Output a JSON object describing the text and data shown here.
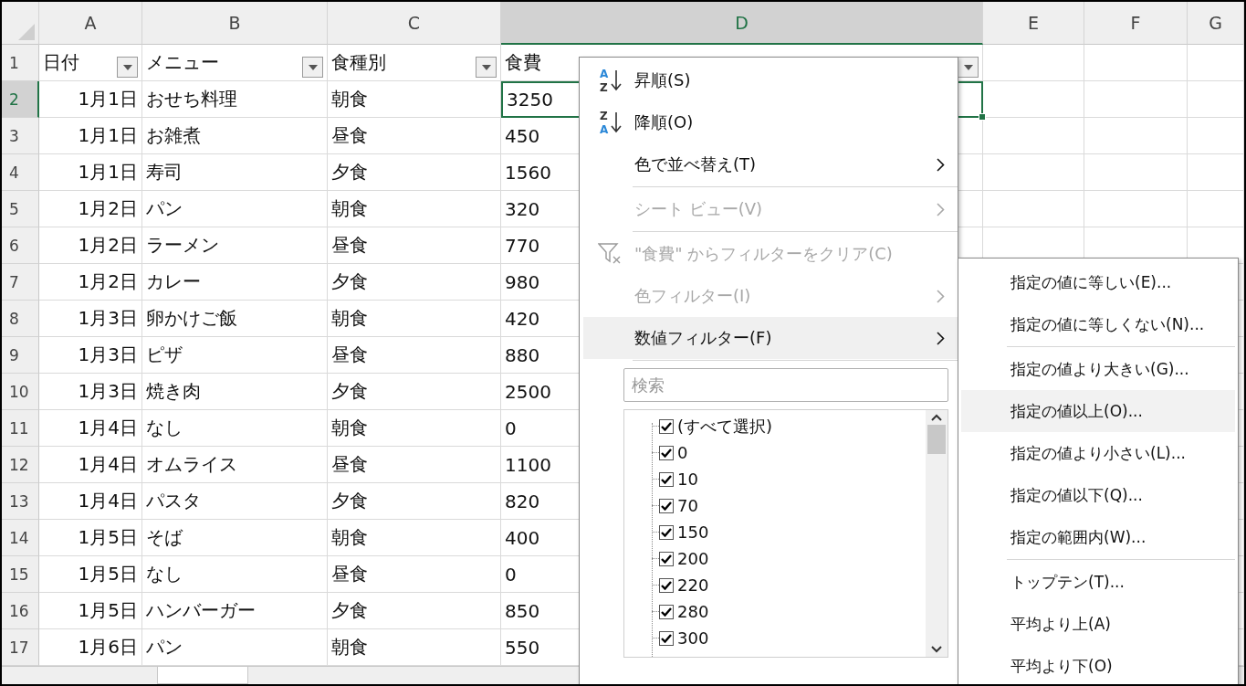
{
  "sheet": {
    "columns": [
      {
        "label": "A",
        "selected": false
      },
      {
        "label": "B",
        "selected": false
      },
      {
        "label": "C",
        "selected": false
      },
      {
        "label": "D",
        "selected": true
      },
      {
        "label": "E",
        "selected": false
      },
      {
        "label": "F",
        "selected": false
      },
      {
        "label": "G",
        "selected": false
      }
    ],
    "header_row": {
      "number": "1",
      "cells": [
        "日付",
        "メニュー",
        "食種別",
        "食費"
      ]
    },
    "rows": [
      {
        "number": "2",
        "selected": true,
        "cells": [
          "1月1日",
          "おせち料理",
          "朝食",
          "3250"
        ]
      },
      {
        "number": "3",
        "selected": false,
        "cells": [
          "1月1日",
          "お雑煮",
          "昼食",
          "450"
        ]
      },
      {
        "number": "4",
        "selected": false,
        "cells": [
          "1月1日",
          "寿司",
          "夕食",
          "1560"
        ]
      },
      {
        "number": "5",
        "selected": false,
        "cells": [
          "1月2日",
          "パン",
          "朝食",
          "320"
        ]
      },
      {
        "number": "6",
        "selected": false,
        "cells": [
          "1月2日",
          "ラーメン",
          "昼食",
          "770"
        ]
      },
      {
        "number": "7",
        "selected": false,
        "cells": [
          "1月2日",
          "カレー",
          "夕食",
          "980"
        ]
      },
      {
        "number": "8",
        "selected": false,
        "cells": [
          "1月3日",
          "卵かけご飯",
          "朝食",
          "420"
        ]
      },
      {
        "number": "9",
        "selected": false,
        "cells": [
          "1月3日",
          "ピザ",
          "昼食",
          "880"
        ]
      },
      {
        "number": "10",
        "selected": false,
        "cells": [
          "1月3日",
          "焼き肉",
          "夕食",
          "2500"
        ]
      },
      {
        "number": "11",
        "selected": false,
        "cells": [
          "1月4日",
          "なし",
          "朝食",
          "0"
        ]
      },
      {
        "number": "12",
        "selected": false,
        "cells": [
          "1月4日",
          "オムライス",
          "昼食",
          "1100"
        ]
      },
      {
        "number": "13",
        "selected": false,
        "cells": [
          "1月4日",
          "パスタ",
          "夕食",
          "820"
        ]
      },
      {
        "number": "14",
        "selected": false,
        "cells": [
          "1月5日",
          "そば",
          "朝食",
          "400"
        ]
      },
      {
        "number": "15",
        "selected": false,
        "cells": [
          "1月5日",
          "なし",
          "昼食",
          "0"
        ]
      },
      {
        "number": "16",
        "selected": false,
        "cells": [
          "1月5日",
          "ハンバーガー",
          "夕食",
          "850"
        ]
      },
      {
        "number": "17",
        "selected": false,
        "cells": [
          "1月6日",
          "パン",
          "朝食",
          "550"
        ]
      }
    ]
  },
  "filter_menu": {
    "items": [
      {
        "kind": "ascending",
        "icon_letters": [
          "A",
          "Z"
        ],
        "label": "昇順(S)",
        "disabled": false,
        "selected": false
      },
      {
        "kind": "descending",
        "icon_letters": [
          "Z",
          "A"
        ],
        "label": "降順(O)",
        "disabled": false,
        "selected": false
      },
      {
        "kind": "submenu",
        "label": "色で並べ替え(T)",
        "disabled": false,
        "selected": false
      },
      {
        "kind": "separator"
      },
      {
        "kind": "submenu",
        "label": "シート ビュー(V)",
        "disabled": true,
        "selected": false
      },
      {
        "kind": "separator"
      },
      {
        "kind": "clear",
        "label": "\"食費\" からフィルターをクリア(C)",
        "disabled": true,
        "selected": false
      },
      {
        "kind": "submenu",
        "label": "色フィルター(I)",
        "disabled": true,
        "selected": false
      },
      {
        "kind": "submenu",
        "label": "数値フィルター(F)",
        "disabled": false,
        "selected": true
      },
      {
        "kind": "separator"
      }
    ],
    "search": {
      "placeholder": "検索"
    },
    "values": [
      {
        "label": "(すべて選択)",
        "checked": true
      },
      {
        "label": "0",
        "checked": true
      },
      {
        "label": "10",
        "checked": true
      },
      {
        "label": "70",
        "checked": true
      },
      {
        "label": "150",
        "checked": true
      },
      {
        "label": "200",
        "checked": true
      },
      {
        "label": "220",
        "checked": true
      },
      {
        "label": "280",
        "checked": true
      },
      {
        "label": "300",
        "checked": true
      }
    ]
  },
  "number_filter_menu": {
    "items": [
      {
        "kind": "item",
        "label": "指定の値に等しい(E)...",
        "selected": false
      },
      {
        "kind": "item",
        "label": "指定の値に等しくない(N)...",
        "selected": false
      },
      {
        "kind": "separator"
      },
      {
        "kind": "item",
        "label": "指定の値より大きい(G)...",
        "selected": false
      },
      {
        "kind": "item",
        "label": "指定の値以上(O)...",
        "selected": true
      },
      {
        "kind": "item",
        "label": "指定の値より小さい(L)...",
        "selected": false
      },
      {
        "kind": "item",
        "label": "指定の値以下(Q)...",
        "selected": false
      },
      {
        "kind": "item",
        "label": "指定の範囲内(W)...",
        "selected": false
      },
      {
        "kind": "separator"
      },
      {
        "kind": "item",
        "label": "トップテン(T)...",
        "selected": false
      },
      {
        "kind": "item",
        "label": "平均より上(A)",
        "selected": false
      },
      {
        "kind": "item",
        "label": "平均より下(O)",
        "selected": false
      }
    ]
  }
}
